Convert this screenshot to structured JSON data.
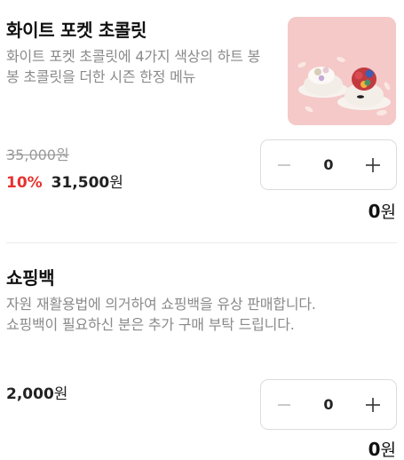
{
  "items": [
    {
      "title": "화이트 포켓 초콜릿",
      "description": "화이트 포켓 초콜릿에 4가지 색상의 하트 봉봉 초콜릿을 더한 시즌 한정 메뉴",
      "original_price": "35,000원",
      "discount": "10%",
      "sale_price": "31,500",
      "currency": "원",
      "quantity": "0",
      "total": "0",
      "image": "white-pocket-chocolate-photo"
    },
    {
      "title": "쇼핑백",
      "description": "자원 재활용법에 의거하여 쇼핑백을 유상 판매합니다.\n쇼핑백이 필요하신 분은 추가 구매 부탁 드립니다.",
      "price": "2,000",
      "currency": "원",
      "quantity": "0",
      "total": "0"
    }
  ],
  "colors": {
    "discount": "#e8322f",
    "border": "#dcdcdc",
    "muted": "#8a8a8a"
  },
  "icons": {
    "decrease": "minus-icon",
    "increase": "plus-icon"
  }
}
